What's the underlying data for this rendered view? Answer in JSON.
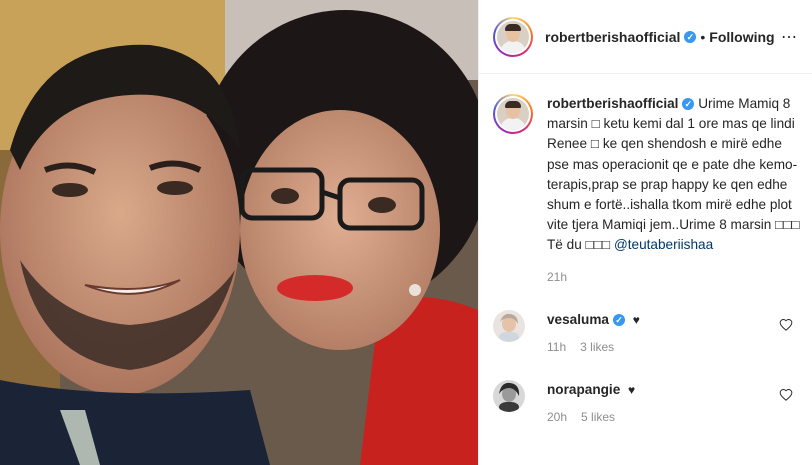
{
  "post": {
    "author": "robertberishaofficial",
    "dot": "•",
    "follow_label": "Following",
    "more_icon": "⋯",
    "caption_text": "Urime Mamiq 8 marsin □ ketu kemi dal 1 ore mas qe lindi Renee □ ke qen shendosh e mirë edhe pse mas operacionit qe e pate dhe kemo-terapis,prap se prap happy ke qen edhe shum e fortë..ishalla tkom mirë edhe plot vite tjera Mamiqi jem..Urime 8 marsin □□□ Të du □□□ ",
    "caption_mention": "@teutaberiishaa",
    "caption_time": "21h"
  },
  "comments": [
    {
      "user": "vesaluma",
      "text": "♥",
      "time": "11h",
      "likes": "3 likes",
      "verified": true
    },
    {
      "user": "norapangie",
      "text": "♥",
      "time": "20h",
      "likes": "5 likes",
      "verified": false
    }
  ],
  "colors": {
    "accent": "#3897f0",
    "mention": "#00376b",
    "meta": "#8e8e8e"
  },
  "icons": {
    "verified": "verified-badge-icon",
    "like": "heart-outline-icon",
    "more": "more-options-icon"
  }
}
